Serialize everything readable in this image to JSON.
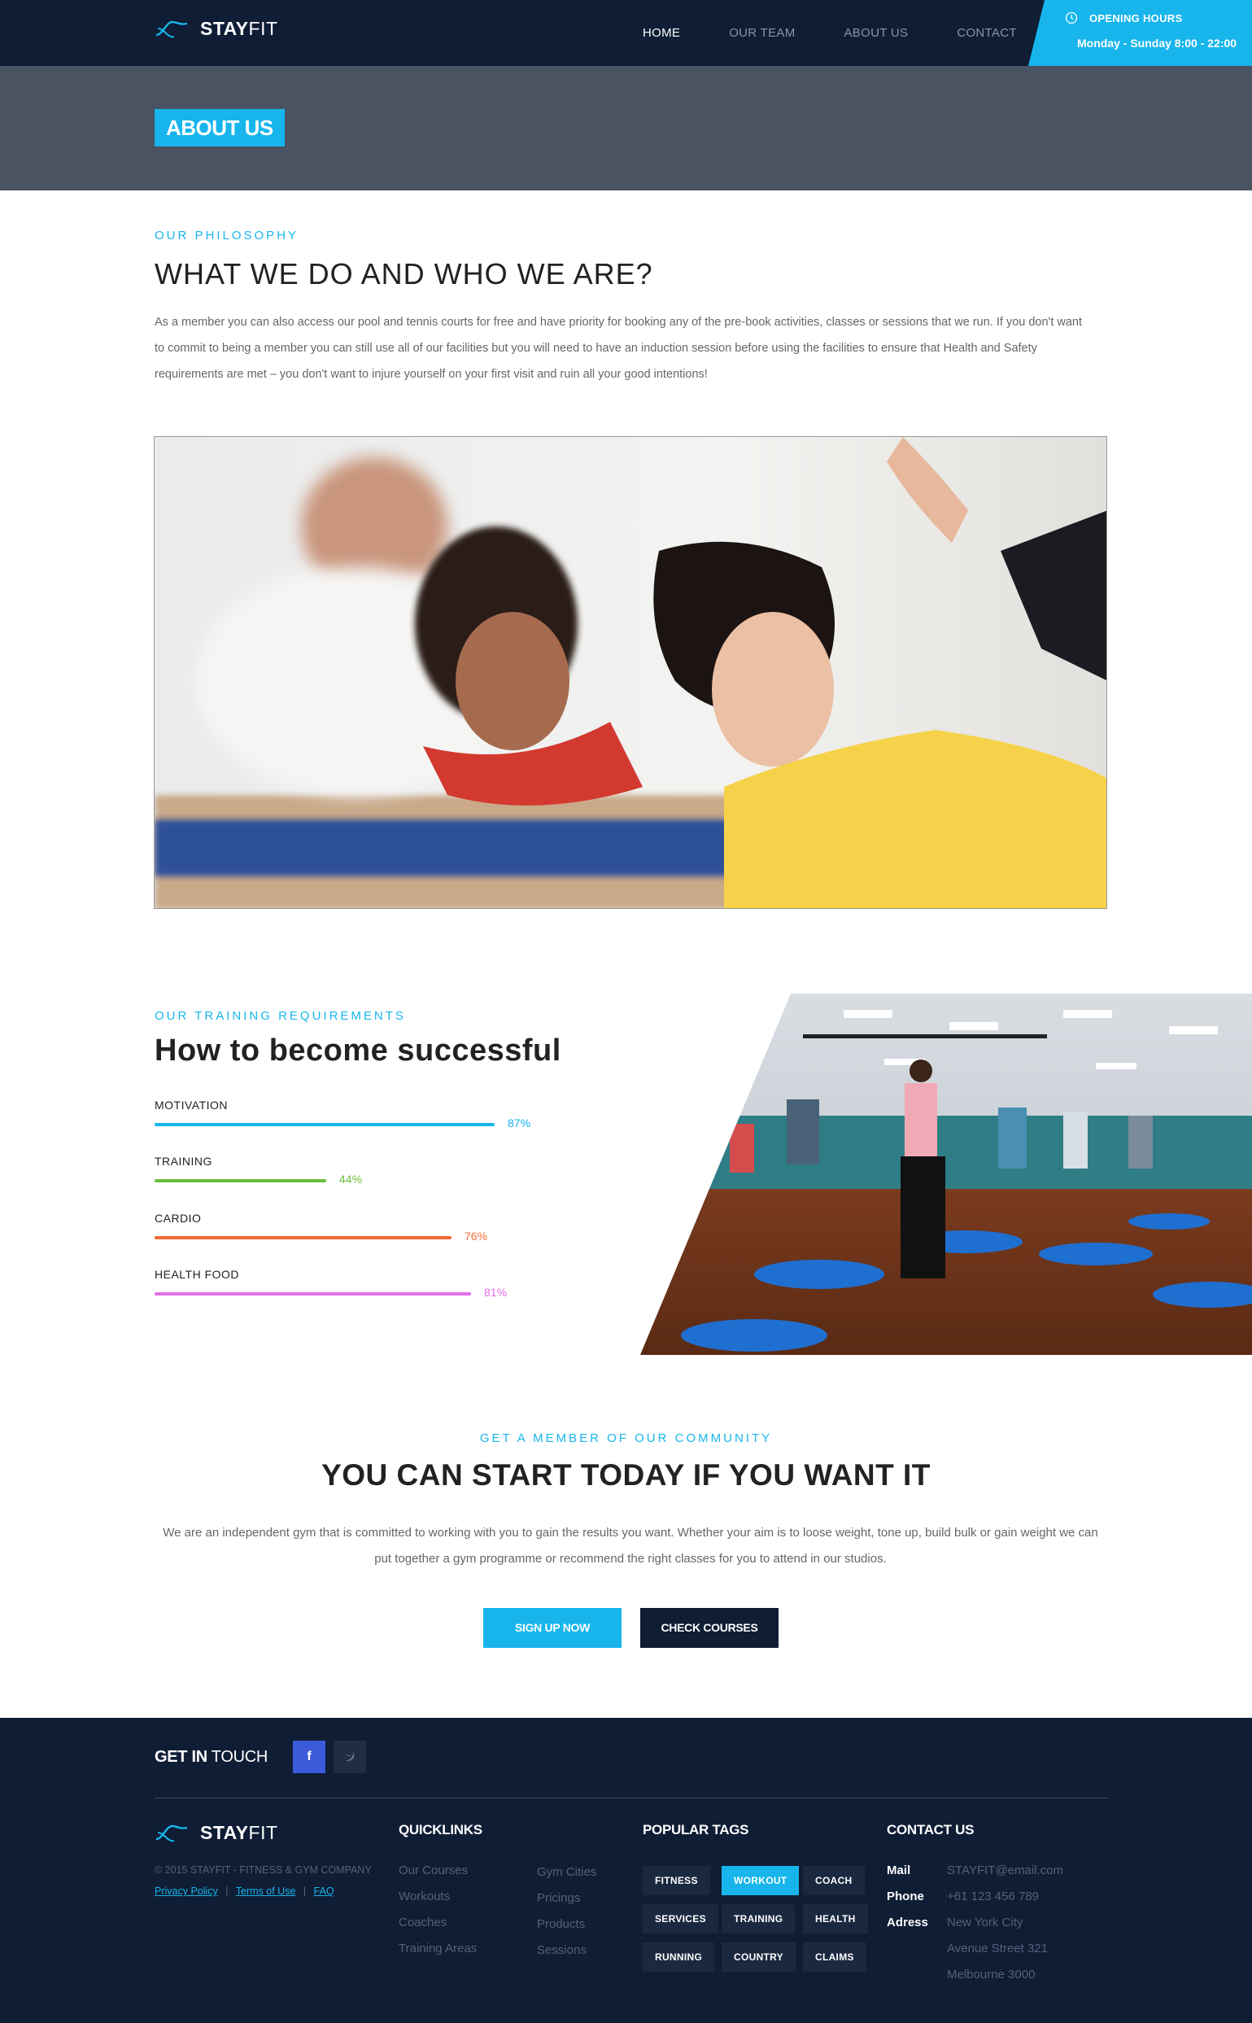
{
  "header": {
    "brand_bold": "STAY",
    "brand_light": "FIT",
    "nav": [
      "HOME",
      "OUR TEAM",
      "ABOUT US",
      "CONTACT"
    ],
    "hours_title": "OPENING HOURS",
    "hours_value": "Monday - Sunday 8:00 - 22:00"
  },
  "banner": {
    "title": "ABOUT US"
  },
  "philosophy": {
    "eyebrow": "OUR PHILOSOPHY",
    "title": "WHAT WE DO AND WHO WE ARE?",
    "text": "As a member you can also access our pool and tennis courts for free and have priority for booking any of the pre-book activities, classes or sessions that we run. If you don't want to commit to being a member you can still use all of our facilities but you will need to have an induction session before using the facilities to ensure that Health and Safety requirements are met – you don't want to injure yourself on your first visit and ruin all your good intentions!"
  },
  "training": {
    "eyebrow": "OUR TRAINING REQUIREMENTS",
    "title": "How to become successful",
    "skills": [
      {
        "label": "MOTIVATION",
        "value": 87,
        "pct": "87%",
        "color": "#17b5ec"
      },
      {
        "label": "TRAINING",
        "value": 44,
        "pct": "44%",
        "color": "#6abf3c"
      },
      {
        "label": "CARDIO",
        "value": 76,
        "pct": "76%",
        "color": "#f26a32"
      },
      {
        "label": "HEALTH FOOD",
        "value": 81,
        "pct": "81%",
        "color": "#e36ee8"
      }
    ]
  },
  "community": {
    "eyebrow": "GET A MEMBER OF OUR COMMUNITY",
    "title": "YOU CAN START TODAY IF YOU WANT IT",
    "text": "We are an independent gym that is committed to working with you to gain the results you want. Whether your aim is to loose weight, tone up, build bulk or gain weight we can put together a gym programme or recommend the right classes for you to attend in our studios.",
    "primary_button": "SIGN UP NOW",
    "secondary_button": "CHECK COURSES"
  },
  "footer": {
    "get_in_bold": "GET IN",
    "get_in_light": "TOUCH",
    "fb": "f",
    "copyright": "© 2015 STAYFIT - FITNESS & GYM COMPANY",
    "links": [
      "Privacy Policy",
      "Terms of Use",
      "FAQ"
    ],
    "link_sep": "|",
    "quicklinks_title": "QUICKLINKS",
    "quicklinks_col1": [
      "Our Courses",
      "Workouts",
      "Coaches",
      "Training Areas"
    ],
    "quicklinks_col2": [
      "Gym Cities",
      "Pricings",
      "Products",
      "Sessions"
    ],
    "tags_title": "POPULAR TAGS",
    "tags": [
      "FITNESS",
      "WORKOUT",
      "COACH",
      "SERVICES",
      "TRAINING",
      "HEALTH",
      "RUNNING",
      "COUNTRY",
      "CLAIMS"
    ],
    "active_tag": "WORKOUT",
    "contact_title": "CONTACT US",
    "mail_label": "Mail",
    "mail_value": "STAYFIT@email.com",
    "phone_label": "Phone",
    "phone_value": "+61 123 456 789",
    "address_label": "Adress",
    "address_lines": [
      "New York City",
      "Avenue Street 321",
      "Melbourne 3000"
    ]
  },
  "colors": {
    "accent": "#17b5ec",
    "navy": "#0f1d35",
    "banner": "#495361"
  }
}
